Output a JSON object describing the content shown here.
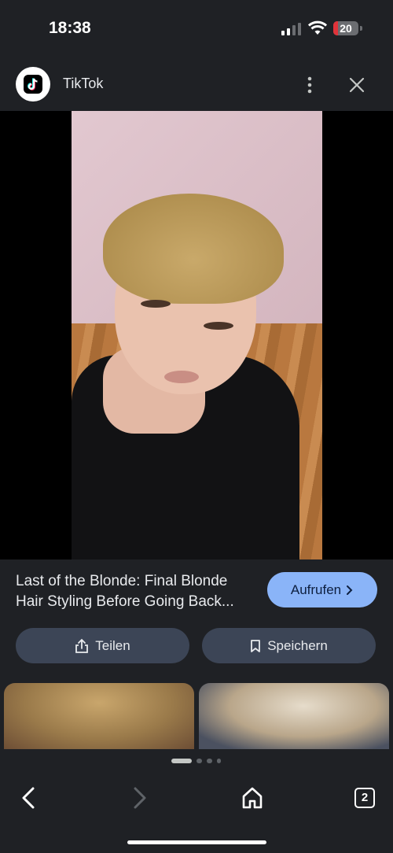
{
  "status": {
    "time": "18:38",
    "battery": "20",
    "battery_level": 0.2
  },
  "header": {
    "site": "TikTok"
  },
  "caption": {
    "title": "Last of the Blonde: Final Blonde Hair Styling Before Going Back..."
  },
  "buttons": {
    "open": "Aufrufen",
    "share": "Teilen",
    "save": "Speichern"
  },
  "bottom": {
    "tabs_count": "2",
    "carousel_pages": 4,
    "carousel_active": 0
  },
  "colors": {
    "accent": "#8ab4f8",
    "button_bg": "#3c4556",
    "background": "#1f2125",
    "battery_red": "#e0333a"
  }
}
